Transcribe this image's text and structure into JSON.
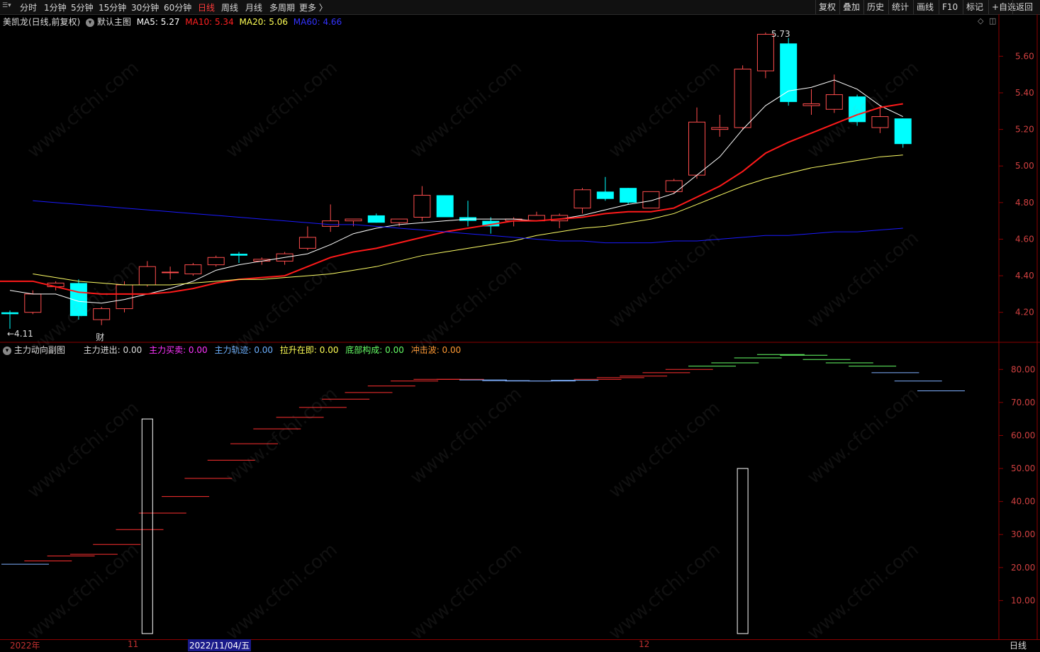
{
  "toolbar": {
    "menu_icon": "menu-icon",
    "left_items": [
      {
        "label": "分时",
        "active": false
      },
      {
        "label": "1分钟",
        "active": false
      },
      {
        "label": "5分钟",
        "active": false
      },
      {
        "label": "15分钟",
        "active": false
      },
      {
        "label": "30分钟",
        "active": false
      },
      {
        "label": "60分钟",
        "active": false
      },
      {
        "label": "日线",
        "active": true
      },
      {
        "label": "周线",
        "active": false
      },
      {
        "label": "月线",
        "active": false
      },
      {
        "label": "多周期",
        "active": false
      },
      {
        "label": "更多 〉",
        "active": false
      }
    ],
    "right_items": [
      "复权",
      "叠加",
      "历史",
      "统计",
      "画线",
      "F10",
      "标记",
      "+自选",
      "返回"
    ]
  },
  "main_legend": {
    "stock_name": "美凯龙(日线,前复权)",
    "chart_name": "默认主图",
    "ma5_label": "MA5: 5.27",
    "ma10_label": "MA10: 5.34",
    "ma20_label": "MA20: 5.06",
    "ma60_label": "MA60: 4.66"
  },
  "sub_legend": {
    "chart_name": "主力动向副图",
    "main_inout": "主力进出: 0.00",
    "main_buysell": "主力买卖: 0.00",
    "main_track": "主力轨迹: 0.00",
    "pullup": "拉升在即: 0.00",
    "bottom_form": "底部构成: 0.00",
    "impact_wave": "冲击波: 0.00"
  },
  "colors": {
    "up": "#ff4d4d",
    "down": "#00ffff",
    "ma5": "#ffffff",
    "ma10": "#ff1a1a",
    "ma20": "#ffff66",
    "ma60": "#1a1aff",
    "axis": "#8b0000",
    "axis_text": "#d04040"
  },
  "annotations": {
    "high_label": "5.73",
    "low_label": "←4.11",
    "event_label": "财"
  },
  "bottom": {
    "year": "2022年",
    "nov": "11",
    "cursor_date": "2022/11/04/五",
    "dec": "12",
    "period": "日线"
  },
  "watermark": "www.cfchi.com",
  "chart_data": [
    {
      "type": "candlestick",
      "title": "美凯龙(日线,前复权)",
      "ylim": [
        4.04,
        5.83
      ],
      "y_ticks": [
        "5.60",
        "5.40",
        "5.20",
        "5.00",
        "4.80",
        "4.60",
        "4.40",
        "4.20"
      ],
      "ohlc": [
        [
          4.2,
          4.21,
          4.11,
          4.19
        ],
        [
          4.2,
          4.32,
          4.19,
          4.3
        ],
        [
          4.34,
          4.37,
          4.32,
          4.36
        ],
        [
          4.36,
          4.38,
          4.16,
          4.18
        ],
        [
          4.16,
          4.23,
          4.13,
          4.22
        ],
        [
          4.22,
          4.37,
          4.2,
          4.35
        ],
        [
          4.35,
          4.48,
          4.34,
          4.45
        ],
        [
          4.42,
          4.45,
          4.38,
          4.42
        ],
        [
          4.41,
          4.47,
          4.4,
          4.46
        ],
        [
          4.46,
          4.51,
          4.45,
          4.5
        ],
        [
          4.52,
          4.53,
          4.47,
          4.51
        ],
        [
          4.48,
          4.5,
          4.46,
          4.49
        ],
        [
          4.48,
          4.53,
          4.46,
          4.52
        ],
        [
          4.55,
          4.67,
          4.54,
          4.61
        ],
        [
          4.67,
          4.79,
          4.64,
          4.7
        ],
        [
          4.7,
          4.71,
          4.67,
          4.71
        ],
        [
          4.73,
          4.74,
          4.69,
          4.69
        ],
        [
          4.69,
          4.71,
          4.67,
          4.71
        ],
        [
          4.72,
          4.89,
          4.7,
          4.84
        ],
        [
          4.84,
          4.84,
          4.72,
          4.72
        ],
        [
          4.72,
          4.81,
          4.67,
          4.7
        ],
        [
          4.7,
          4.72,
          4.63,
          4.67
        ],
        [
          4.7,
          4.72,
          4.67,
          4.71
        ],
        [
          4.7,
          4.75,
          4.7,
          4.73
        ],
        [
          4.7,
          4.74,
          4.66,
          4.73
        ],
        [
          4.77,
          4.88,
          4.74,
          4.87
        ],
        [
          4.86,
          4.94,
          4.81,
          4.82
        ],
        [
          4.88,
          4.88,
          4.79,
          4.8
        ],
        [
          4.77,
          4.86,
          4.77,
          4.86
        ],
        [
          4.86,
          4.93,
          4.85,
          4.92
        ],
        [
          4.95,
          5.32,
          4.93,
          5.24
        ],
        [
          5.2,
          5.28,
          5.16,
          5.21
        ],
        [
          5.21,
          5.55,
          5.2,
          5.53
        ],
        [
          5.52,
          5.73,
          5.48,
          5.72
        ],
        [
          5.67,
          5.7,
          5.33,
          5.35
        ],
        [
          5.33,
          5.42,
          5.28,
          5.34
        ],
        [
          5.31,
          5.5,
          5.29,
          5.39
        ],
        [
          5.38,
          5.39,
          5.22,
          5.24
        ],
        [
          5.21,
          5.33,
          5.18,
          5.27
        ],
        [
          5.26,
          5.26,
          5.1,
          5.12
        ]
      ],
      "series": [
        {
          "name": "MA5",
          "values": [
            4.32,
            4.3,
            4.3,
            4.26,
            4.25,
            4.27,
            4.3,
            4.33,
            4.37,
            4.43,
            4.46,
            4.48,
            4.5,
            4.52,
            4.57,
            4.63,
            4.66,
            4.68,
            4.69,
            4.7,
            4.71,
            4.71,
            4.71,
            4.7,
            4.71,
            4.73,
            4.76,
            4.79,
            4.81,
            4.85,
            4.95,
            5.05,
            5.2,
            5.33,
            5.41,
            5.43,
            5.47,
            5.42,
            5.33,
            5.27
          ]
        },
        {
          "name": "MA10",
          "values": [
            4.37,
            4.37,
            4.37,
            4.34,
            4.31,
            4.3,
            4.3,
            4.3,
            4.31,
            4.33,
            4.36,
            4.38,
            4.39,
            4.4,
            4.45,
            4.5,
            4.53,
            4.55,
            4.58,
            4.61,
            4.64,
            4.66,
            4.68,
            4.7,
            4.7,
            4.71,
            4.72,
            4.74,
            4.75,
            4.75,
            4.77,
            4.83,
            4.89,
            4.97,
            5.07,
            5.13,
            5.18,
            5.23,
            5.28,
            5.32,
            5.34
          ]
        },
        {
          "name": "MA20",
          "values": [
            4.41,
            4.39,
            4.37,
            4.36,
            4.35,
            4.35,
            4.35,
            4.36,
            4.37,
            4.38,
            4.38,
            4.39,
            4.4,
            4.41,
            4.43,
            4.45,
            4.48,
            4.51,
            4.53,
            4.55,
            4.57,
            4.59,
            4.62,
            4.64,
            4.66,
            4.67,
            4.69,
            4.71,
            4.74,
            4.79,
            4.84,
            4.89,
            4.93,
            4.96,
            4.99,
            5.01,
            5.03,
            5.05,
            5.06
          ]
        },
        {
          "name": "MA60",
          "values": [
            4.81,
            4.8,
            4.79,
            4.78,
            4.77,
            4.76,
            4.75,
            4.74,
            4.73,
            4.72,
            4.71,
            4.7,
            4.69,
            4.68,
            4.68,
            4.67,
            4.66,
            4.65,
            4.64,
            4.63,
            4.62,
            4.61,
            4.6,
            4.59,
            4.59,
            4.58,
            4.58,
            4.58,
            4.59,
            4.59,
            4.6,
            4.61,
            4.62,
            4.62,
            4.63,
            4.64,
            4.64,
            4.65,
            4.66
          ]
        }
      ]
    },
    {
      "type": "bar",
      "title": "主力动向副图",
      "ylim": [
        0,
        88
      ],
      "y_ticks": [
        "80.00",
        "70.00",
        "60.00",
        "50.00",
        "40.00",
        "30.00",
        "20.00",
        "10.00"
      ],
      "white_bars": [
        {
          "index": 6,
          "value": 65
        },
        {
          "index": 32,
          "value": 50
        }
      ],
      "step_segments": [
        {
          "start": 0,
          "value": 21.0,
          "color": "#7fb0ff"
        },
        {
          "start": 1,
          "value": 22.0,
          "color": "#ff3030"
        },
        {
          "start": 2,
          "value": 23.5,
          "color": "#ff3030"
        },
        {
          "start": 3,
          "value": 24.0,
          "color": "#ff3030"
        },
        {
          "start": 4,
          "value": 27.0,
          "color": "#ff3030"
        },
        {
          "start": 5,
          "value": 31.5,
          "color": "#ff3030"
        },
        {
          "start": 6,
          "value": 36.5,
          "color": "#ff3030"
        },
        {
          "start": 7,
          "value": 41.5,
          "color": "#ff3030"
        },
        {
          "start": 8,
          "value": 47.0,
          "color": "#ff3030"
        },
        {
          "start": 9,
          "value": 52.5,
          "color": "#ff3030"
        },
        {
          "start": 10,
          "value": 57.5,
          "color": "#ff3030"
        },
        {
          "start": 11,
          "value": 62.0,
          "color": "#ff3030"
        },
        {
          "start": 12,
          "value": 65.5,
          "color": "#ff3030"
        },
        {
          "start": 13,
          "value": 68.5,
          "color": "#ff3030"
        },
        {
          "start": 14,
          "value": 71.0,
          "color": "#ff3030"
        },
        {
          "start": 15,
          "value": 73.0,
          "color": "#ff3030"
        },
        {
          "start": 16,
          "value": 75.0,
          "color": "#ff3030"
        },
        {
          "start": 17,
          "value": 76.5,
          "color": "#ff3030"
        },
        {
          "start": 18,
          "value": 77.0,
          "color": "#ff3030"
        },
        {
          "start": 19,
          "value": 77.0,
          "color": "#ff3030"
        },
        {
          "start": 20,
          "value": 76.8,
          "color": "#7fb0ff"
        },
        {
          "start": 21,
          "value": 76.6,
          "color": "#7fb0ff"
        },
        {
          "start": 22,
          "value": 76.5,
          "color": "#7fb0ff"
        },
        {
          "start": 23,
          "value": 76.5,
          "color": "#7fb0ff"
        },
        {
          "start": 24,
          "value": 76.7,
          "color": "#7fb0ff"
        },
        {
          "start": 25,
          "value": 77.0,
          "color": "#ff3030"
        },
        {
          "start": 26,
          "value": 77.5,
          "color": "#ff3030"
        },
        {
          "start": 27,
          "value": 78.0,
          "color": "#ff3030"
        },
        {
          "start": 28,
          "value": 79.0,
          "color": "#ff3030"
        },
        {
          "start": 29,
          "value": 80.0,
          "color": "#ff3030"
        },
        {
          "start": 30,
          "value": 81.0,
          "color": "#66ff66"
        },
        {
          "start": 31,
          "value": 82.0,
          "color": "#66ff66"
        },
        {
          "start": 32,
          "value": 83.5,
          "color": "#66ff66"
        },
        {
          "start": 33,
          "value": 84.5,
          "color": "#66ff66"
        },
        {
          "start": 34,
          "value": 84.3,
          "color": "#66ff66"
        },
        {
          "start": 35,
          "value": 83.0,
          "color": "#66ff66"
        },
        {
          "start": 36,
          "value": 82.0,
          "color": "#66ff66"
        },
        {
          "start": 37,
          "value": 81.0,
          "color": "#66ff66"
        },
        {
          "start": 38,
          "value": 79.0,
          "color": "#7fb0ff"
        },
        {
          "start": 39,
          "value": 76.5,
          "color": "#7fb0ff"
        },
        {
          "start": 40,
          "value": 73.5,
          "color": "#7fb0ff"
        }
      ]
    }
  ]
}
